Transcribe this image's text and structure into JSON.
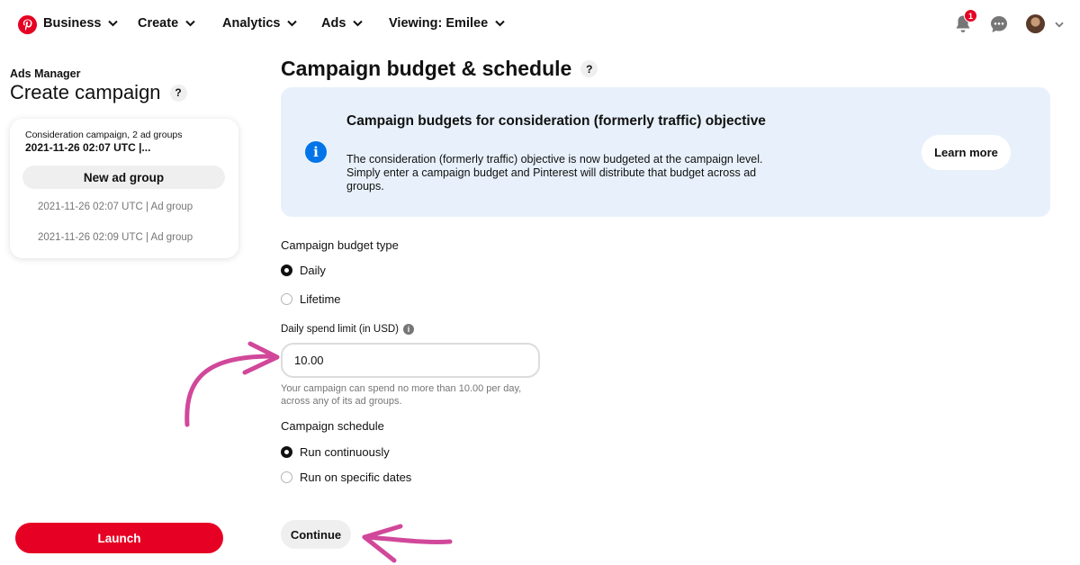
{
  "nav": {
    "brand": "Business",
    "items": [
      "Create",
      "Analytics",
      "Ads"
    ],
    "viewing": "Viewing: Emilee",
    "notification_count": "1"
  },
  "sidebar": {
    "section": "Ads Manager",
    "title": "Create campaign",
    "help": "?",
    "campaign_subtitle": "Consideration campaign, 2 ad groups",
    "campaign_title": "2021-11-26 02:07 UTC |...",
    "new_ad_group_label": "New ad group",
    "ad_groups": [
      "2021-11-26 02:07 UTC | Ad group",
      "2021-11-26 02:09 UTC | Ad group"
    ],
    "launch_label": "Launch"
  },
  "main": {
    "title": "Campaign budget & schedule",
    "help": "?",
    "info": {
      "icon": "i",
      "heading": "Campaign budgets for consideration (formerly traffic) objective",
      "body": "The consideration (formerly traffic) objective is now budgeted at the campaign level. Simply enter a campaign budget and Pinterest will distribute that budget across ad groups.",
      "button": "Learn more"
    },
    "budget_type_label": "Campaign budget type",
    "budget_options": [
      "Daily",
      "Lifetime"
    ],
    "selected_budget": "Daily",
    "spend_label": "Daily spend limit (in USD)",
    "spend_info": "i",
    "spend_value": "10.00",
    "spend_helper": "Your campaign can spend no more than 10.00 per day, across any of its ad groups.",
    "schedule_label": "Campaign schedule",
    "schedule_options": [
      "Run continuously",
      "Run on specific dates"
    ],
    "selected_schedule": "Run continuously",
    "continue_label": "Continue"
  },
  "colors": {
    "brand_red": "#e60023",
    "info_bg": "#e8f1fb",
    "info_blue": "#0074e8",
    "annotation_pink": "#d1489a"
  },
  "icons": [
    "pinterest-logo-icon",
    "chevron-down-icon",
    "bell-icon",
    "speech-bubble-icon",
    "info-icon"
  ]
}
